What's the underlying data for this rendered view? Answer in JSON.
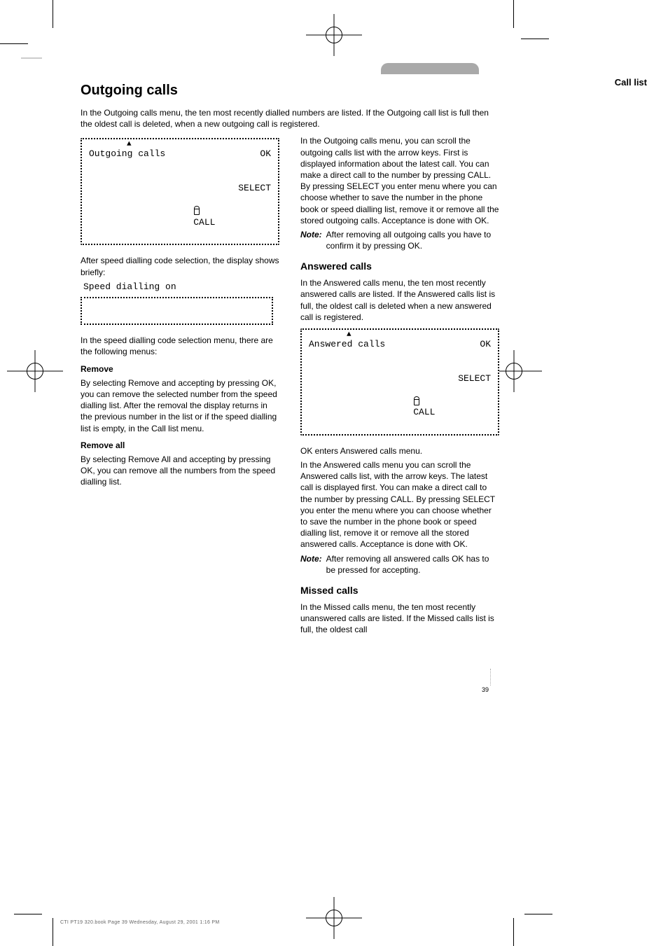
{
  "chapter": "Call list",
  "section_title": "Outgoing calls",
  "section_intro": "In the Outgoing calls menu, the ten most recently dialled numbers are listed. If the Outgoing call list is full then the oldest call is deleted, when a new outgoing call is registered.",
  "lcd1": {
    "line1": "Outgoing calls",
    "right1": "OK",
    "line3_right": "SELECT",
    "line4_left": "CALL"
  },
  "speed_text_above": "After speed dialling code selection, the display shows briefly:",
  "speed_box_line": "Speed dialling on",
  "speed_intro": "In the speed dialling code selection menu, there are the following menus:",
  "speed_remove_h": "Remove",
  "speed_remove_p": "By selecting Remove and accepting by pressing OK, you can remove the selected number from the speed dialling list. After the removal the display returns in the previous number in the list or if the speed dialling list is empty, in the Call list menu.",
  "speed_removeall_h": "Remove all",
  "speed_removeall_p": "By selecting Remove All and accepting by pressing OK, you can remove all the numbers from the speed dialling list.",
  "lcd2": {
    "line1": "Answered calls",
    "right1": "OK",
    "line3_right": "SELECT",
    "line4_left": "CALL"
  },
  "outgoing_main_p": "In the Outgoing calls menu, you can scroll the outgoing calls list with the arrow keys. First is displayed information about the latest call. You can make a direct call to the number by pressing CALL. By pressing SELECT you enter menu where you can choose whether to save the number in the phone book or speed dialling list, remove it or remove all the stored outgoing calls. Acceptance is done with OK.",
  "note_label": "Note:",
  "outgoing_note": "After removing all outgoing calls you have to confirm it by pressing OK.",
  "answered_h": "Answered calls",
  "answered_p1": "In the Answered calls menu, the ten most recently answered calls are listed. If the Answered calls list is full, the oldest call is deleted when a new answered call is registered.",
  "answered_ok_p": "OK enters Answered calls menu.",
  "answered_main_p": "In the Answered calls menu you can scroll the Answered calls list, with the arrow keys. The latest call is displayed first. You can make a direct call to the number by pressing CALL. By pressing SELECT you enter the menu where you can choose whether to save the number in the phone book or speed dialling list, remove it or remove all the stored answered calls. Acceptance is done with OK.",
  "answered_note": "After removing all answered calls OK has to be pressed for accepting.",
  "missed_h": "Missed calls",
  "missed_p1": "In the Missed calls menu, the ten most recently unanswered calls are listed. If the Missed calls list is full, the oldest call",
  "pagenum": "39",
  "footer": "CTI PT19 320.book  Page 39  Wednesday, August 29, 2001  1:16 PM"
}
